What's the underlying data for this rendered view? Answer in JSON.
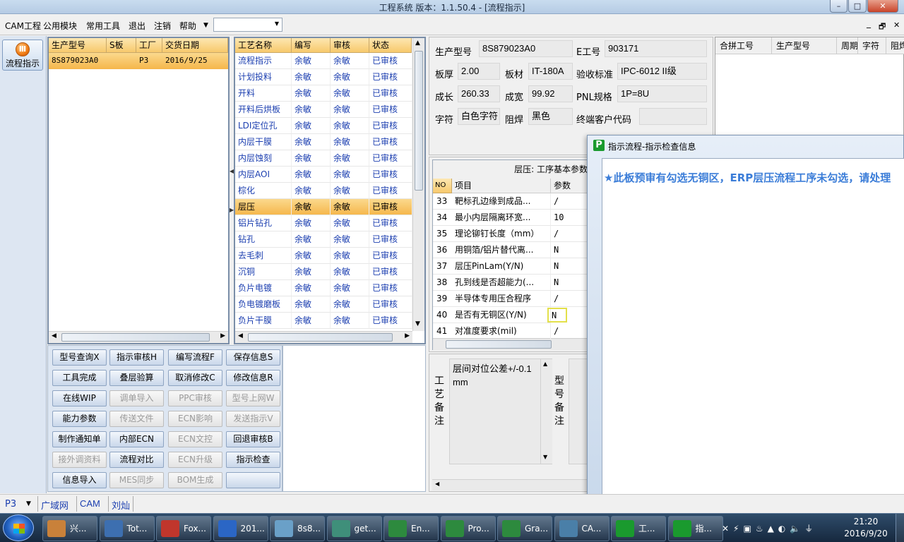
{
  "window": {
    "title": "工程系统   版本：1.1.50.4 - [流程指示]",
    "min": "–",
    "max": "□",
    "close": "✕"
  },
  "menu": [
    "CAM工程",
    "公用模块",
    "常用工具",
    "退出",
    "注销",
    "帮助"
  ],
  "mdi_controls": [
    "_",
    "🗗",
    "✕"
  ],
  "left_button": "流程指示",
  "product_table": {
    "headers": [
      "生产型号",
      "S板",
      "工厂",
      "交货日期"
    ],
    "rows": [
      [
        "8S879023A0",
        "",
        "P3",
        "2016/9/25"
      ]
    ]
  },
  "process_table": {
    "headers": [
      "工艺名称",
      "编写",
      "审核",
      "状态"
    ],
    "rows": [
      [
        "流程指示",
        "余敏",
        "余敏",
        "已审核"
      ],
      [
        "计划投料",
        "余敏",
        "余敏",
        "已审核"
      ],
      [
        "开料",
        "余敏",
        "余敏",
        "已审核"
      ],
      [
        "开料后烘板",
        "余敏",
        "余敏",
        "已审核"
      ],
      [
        "LDI定位孔",
        "余敏",
        "余敏",
        "已审核"
      ],
      [
        "内层干膜",
        "余敏",
        "余敏",
        "已审核"
      ],
      [
        "内层蚀刻",
        "余敏",
        "余敏",
        "已审核"
      ],
      [
        "内层AOI",
        "余敏",
        "余敏",
        "已审核"
      ],
      [
        "棕化",
        "余敏",
        "余敏",
        "已审核"
      ],
      [
        "层压",
        "余敏",
        "余敏",
        "已审核"
      ],
      [
        "铝片钻孔",
        "余敏",
        "余敏",
        "已审核"
      ],
      [
        "钻孔",
        "余敏",
        "余敏",
        "已审核"
      ],
      [
        "去毛刺",
        "余敏",
        "余敏",
        "已审核"
      ],
      [
        "沉铜",
        "余敏",
        "余敏",
        "已审核"
      ],
      [
        "负片电镀",
        "余敏",
        "余敏",
        "已审核"
      ],
      [
        "负电镀磨板",
        "余敏",
        "余敏",
        "已审核"
      ],
      [
        "负片干膜",
        "余敏",
        "余敏",
        "已审核"
      ]
    ],
    "selected_index": 9
  },
  "buttons": [
    [
      {
        "t": "型号查询X",
        "d": false
      },
      {
        "t": "指示审核H",
        "d": false
      },
      {
        "t": "编写流程F",
        "d": false
      },
      {
        "t": "保存信息S",
        "d": false
      }
    ],
    [
      {
        "t": "工具完成",
        "d": false
      },
      {
        "t": "叠层验算",
        "d": false
      },
      {
        "t": "取消修改C",
        "d": false
      },
      {
        "t": "修改信息R",
        "d": false
      }
    ],
    [
      {
        "t": "在线WIP",
        "d": false
      },
      {
        "t": "调单导入",
        "d": true
      },
      {
        "t": "PPC审核",
        "d": true
      },
      {
        "t": "型号上网W",
        "d": true
      }
    ],
    [
      {
        "t": "能力参数",
        "d": false
      },
      {
        "t": "传送文件",
        "d": true
      },
      {
        "t": "ECN影响",
        "d": true
      },
      {
        "t": "发送指示V",
        "d": true
      }
    ],
    [
      {
        "t": "制作通知单",
        "d": false
      },
      {
        "t": "内部ECN",
        "d": false
      },
      {
        "t": "ECN文控",
        "d": true
      },
      {
        "t": "回退审核B",
        "d": false
      }
    ],
    [
      {
        "t": "接外调资料",
        "d": true
      },
      {
        "t": "流程对比",
        "d": false
      },
      {
        "t": "ECN升级",
        "d": true
      },
      {
        "t": "指示检查",
        "d": false
      }
    ],
    [
      {
        "t": "信息导入",
        "d": false
      },
      {
        "t": "MES同步",
        "d": true
      },
      {
        "t": "BOM生成",
        "d": true
      },
      {
        "t": "",
        "d": false
      }
    ]
  ],
  "info": {
    "rows": [
      [
        {
          "l": "生产型号",
          "v": "8S879023A0"
        },
        {
          "l": "E工号",
          "v": "903171"
        }
      ],
      [
        {
          "l": "板厚",
          "v": "2.00"
        },
        {
          "l": "板材",
          "v": "IT-180A"
        },
        {
          "l": "验收标准",
          "v": "IPC-6012 II级"
        }
      ],
      [
        {
          "l": "成长",
          "v": "260.33"
        },
        {
          "l": "成宽",
          "v": "99.92"
        },
        {
          "l": "PNL规格",
          "v": "1P=8U"
        }
      ],
      [
        {
          "l": "字符",
          "v": "白色字符"
        },
        {
          "l": "阻焊",
          "v": "黑色"
        },
        {
          "l": "终端客户代码",
          "v": ""
        }
      ]
    ]
  },
  "right_table": {
    "headers": [
      "合拼工号",
      "生产型号",
      "周期",
      "字符",
      "阻焊"
    ]
  },
  "params": {
    "title": "层压: 工序基本参数",
    "headers": [
      "NO",
      "项目",
      "参数"
    ],
    "rows": [
      [
        "33",
        "靶标孔边缘到成品...",
        "/"
      ],
      [
        "34",
        "最小内层隔离环宽...",
        "10"
      ],
      [
        "35",
        "理论铆钉长度（mm）",
        "/"
      ],
      [
        "36",
        "用铜箔/铝片替代离...",
        "N"
      ],
      [
        "37",
        "层压PinLam(Y/N)",
        "N"
      ],
      [
        "38",
        "孔到线是否超能力(...",
        "N"
      ],
      [
        "39",
        "半导体专用压合程序",
        "/"
      ],
      [
        "40",
        "是否有无铜区(Y/N)",
        "N"
      ],
      [
        "41",
        "对准度要求(mil)",
        "/"
      ]
    ],
    "highlight_index": 7
  },
  "process_note": {
    "label": "工艺备注",
    "text": "层间对位公差+/-0.1mm"
  },
  "model_note": {
    "label": "型号备注"
  },
  "dialog": {
    "title": "指示流程-指示检查信息",
    "message": "★此板预审有勾选无铜区，ERP层压流程工序未勾选，请处理"
  },
  "statusbar": {
    "factory": "P3",
    "items": [
      "广域网",
      "CAM",
      "刘灿"
    ]
  },
  "taskbar": {
    "tasks": [
      "兴...",
      "Tot...",
      "Fox...",
      "201...",
      "8s8...",
      "get...",
      "En...",
      "Pro...",
      "Gra...",
      "CA...",
      "工...",
      "指..."
    ],
    "time": "21:20",
    "date": "2016/9/20"
  },
  "colors": {
    "header": "#f7c96c",
    "selected": "#f5b64a",
    "link": "#1c3fb0",
    "dialog_text": "#3b7dd8"
  }
}
